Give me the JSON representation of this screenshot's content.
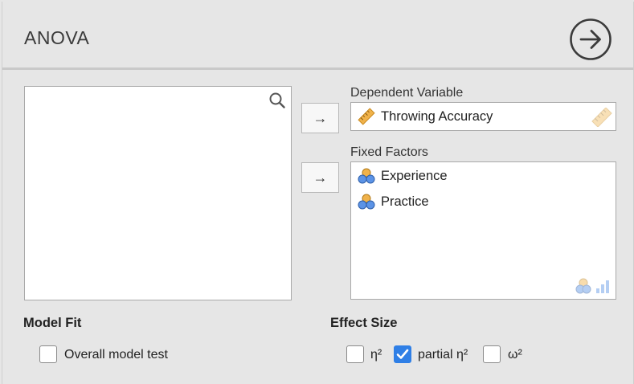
{
  "title": "ANOVA",
  "dependent": {
    "label": "Dependent Variable",
    "value": "Throwing Accuracy"
  },
  "fixed": {
    "label": "Fixed Factors",
    "items": [
      "Experience",
      "Practice"
    ]
  },
  "model_fit": {
    "heading": "Model Fit",
    "overall": "Overall model test",
    "overall_checked": false
  },
  "effect_size": {
    "heading": "Effect Size",
    "eta": "η²",
    "partial_eta": "partial η²",
    "omega": "ω²",
    "eta_checked": false,
    "partial_checked": true,
    "omega_checked": false
  },
  "arrows": {
    "symbol": "→"
  },
  "colors": {
    "accent": "#2f7fe6",
    "ruler": "#f0b24a",
    "nominal_top": "#f0b24a",
    "nominal_bottom": "#5b93e6"
  }
}
